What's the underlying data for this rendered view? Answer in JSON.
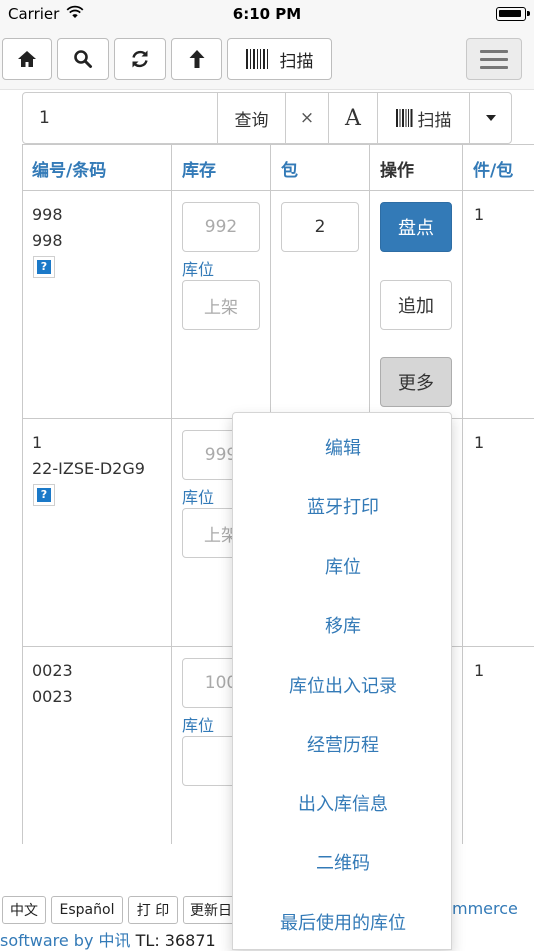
{
  "status_bar": {
    "carrier": "Carrier",
    "time": "6:10 PM"
  },
  "toolbar": {
    "scan_label": "扫描"
  },
  "search": {
    "value": "1",
    "query_label": "查询",
    "clear_label": "×",
    "font_label": "A",
    "scan_label": "扫描"
  },
  "table": {
    "headers": [
      "编号/条码",
      "库存",
      "包",
      "操作",
      "件/包"
    ],
    "rows": [
      {
        "code": "998",
        "barcode": "998",
        "stock_placeholder": "992",
        "location_label": "库位",
        "shelf_placeholder": "上架",
        "package_qty": "2",
        "pieces": "1"
      },
      {
        "code": "1",
        "barcode": "22-IZSE-D2G9",
        "stock_placeholder": "999",
        "location_label": "库位",
        "shelf_placeholder": "上架",
        "pieces": "1"
      },
      {
        "code": "0023",
        "barcode": "0023",
        "stock_placeholder": "100",
        "location_label": "库位",
        "pieces": "1"
      }
    ],
    "actions": {
      "stocktake": "盘点",
      "append": "追加",
      "more": "更多"
    },
    "help_mark": "?"
  },
  "dropdown": {
    "items": [
      "编辑",
      "蓝牙打印",
      "库位",
      "移库",
      "库位出入记录",
      "经营历程",
      "出入库信息",
      "二维码",
      "最后使用的库位"
    ]
  },
  "footer": {
    "buttons": [
      "中文",
      "Español",
      "打 印",
      "更新日"
    ],
    "ecommerce_text": "mmerce",
    "software_text": "software by",
    "company": "中讯",
    "phone": "TL: 36871"
  },
  "colors": {
    "accent": "#337ab7",
    "primary_button": "#337ab7"
  }
}
